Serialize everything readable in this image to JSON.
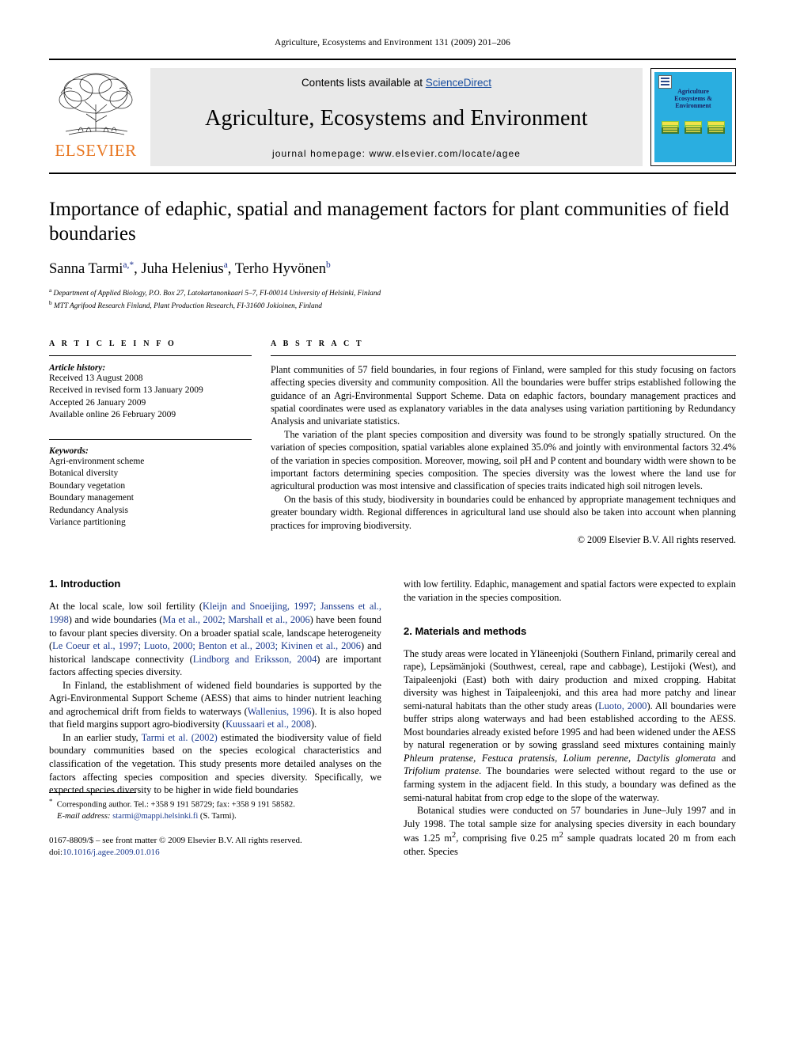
{
  "running_head": "Agriculture, Ecosystems and Environment 131 (2009) 201–206",
  "masthead": {
    "contents_prefix": "Contents lists available at ",
    "sciencedirect": "ScienceDirect",
    "journal_title": "Agriculture, Ecosystems and Environment",
    "homepage": "journal homepage: www.elsevier.com/locate/agee",
    "publisher_wordmark": "ELSEVIER",
    "cover_title": "Agriculture\nEcosystems &\nEnvironment"
  },
  "article": {
    "title": "Importance of edaphic, spatial and management factors for plant communities of field boundaries",
    "authors_html": "Sanna Tarmi<sup>a,*</sup>, Juha Helenius<sup>a</sup>, Terho Hyvönen<sup>b</sup>",
    "affiliation_a": "Department of Applied Biology, P.O. Box 27, Latokartanonkaari 5–7, FI-00014 University of Helsinki, Finland",
    "affiliation_b": "MTT Agrifood Research Finland, Plant Production Research, FI-31600 Jokioinen, Finland"
  },
  "article_info": {
    "heading": "A R T I C L E   I N F O",
    "history_label": "Article history:",
    "history": [
      "Received 13 August 2008",
      "Received in revised form 13 January 2009",
      "Accepted 26 January 2009",
      "Available online 26 February 2009"
    ],
    "keywords_label": "Keywords:",
    "keywords": [
      "Agri-environment scheme",
      "Botanical diversity",
      "Boundary vegetation",
      "Boundary management",
      "Redundancy Analysis",
      "Variance partitioning"
    ]
  },
  "abstract": {
    "heading": "A B S T R A C T",
    "paragraphs": [
      "Plant communities of 57 field boundaries, in four regions of Finland, were sampled for this study focusing on factors affecting species diversity and community composition. All the boundaries were buffer strips established following the guidance of an Agri-Environmental Support Scheme. Data on edaphic factors, boundary management practices and spatial coordinates were used as explanatory variables in the data analyses using variation partitioning by Redundancy Analysis and univariate statistics.",
      "The variation of the plant species composition and diversity was found to be strongly spatially structured. On the variation of species composition, spatial variables alone explained 35.0% and jointly with environmental factors 32.4% of the variation in species composition. Moreover, mowing, soil pH and P content and boundary width were shown to be important factors determining species composition. The species diversity was the lowest where the land use for agricultural production was most intensive and classification of species traits indicated high soil nitrogen levels.",
      "On the basis of this study, biodiversity in boundaries could be enhanced by appropriate management techniques and greater boundary width. Regional differences in agricultural land use should also be taken into account when planning practices for improving biodiversity."
    ],
    "copyright": "© 2009 Elsevier B.V. All rights reserved."
  },
  "sections": {
    "introduction_heading": "1. Introduction",
    "methods_heading": "2. Materials and methods"
  },
  "body": {
    "intro_p1_html": "At the local scale, low soil fertility (<span class=\"cite\">Kleijn and Snoeijing, 1997; Janssens et al., 1998</span>) and wide boundaries (<span class=\"cite\">Ma et al., 2002; Marshall et al., 2006</span>) have been found to favour plant species diversity. On a broader spatial scale, landscape heterogeneity (<span class=\"cite\">Le Coeur et al., 1997; Luoto, 2000; Benton et al., 2003; Kivinen et al., 2006</span>) and historical landscape connectivity (<span class=\"cite\">Lindborg and Eriksson, 2004</span>) are important factors affecting species diversity.",
    "intro_p2_html": "In Finland, the establishment of widened field boundaries is supported by the Agri-Environmental Support Scheme (AESS) that aims to hinder nutrient leaching and agrochemical drift from fields to waterways (<span class=\"cite\">Wallenius, 1996</span>). It is also hoped that field margins support agro-biodiversity (<span class=\"cite\">Kuussaari et al., 2008</span>).",
    "intro_p3_html": "In an earlier study, <span class=\"cite\">Tarmi et al. (2002)</span> estimated the biodiversity value of field boundary communities based on the species ecological characteristics and classification of the vegetation. This study presents more detailed analyses on the factors affecting species composition and species diversity. Specifically, we expected species diversity to be higher in wide field boundaries",
    "intro_p4_html": "with low fertility. Edaphic, management and spatial factors were expected to explain the variation in the species composition.",
    "methods_p1_html": "The study areas were located in Yläneenjoki (Southern Finland, primarily cereal and rape), Lepsämänjoki (Southwest, cereal, rape and cabbage), Lestijoki (West), and Taipaleenjoki (East) both with dairy production and mixed cropping. Habitat diversity was highest in Taipaleenjoki, and this area had more patchy and linear semi-natural habitats than the other study areas (<span class=\"cite\">Luoto, 2000</span>). All boundaries were buffer strips along waterways and had been established according to the AESS. Most boundaries already existed before 1995 and had been widened under the AESS by natural regeneration or by sowing grassland seed mixtures containing mainly <span class=\"ital\">Phleum pratense</span>, <span class=\"ital\">Festuca pratensis</span>, <span class=\"ital\">Lolium perenne</span>, <span class=\"ital\">Dactylis glomerata</span> and <span class=\"ital\">Trifolium pratense</span>. The boundaries were selected without regard to the use or farming system in the adjacent field. In this study, a boundary was defined as the semi-natural habitat from crop edge to the slope of the waterway.",
    "methods_p2_html": "Botanical studies were conducted on 57 boundaries in June–July 1997 and in July 1998. The total sample size for analysing species diversity in each boundary was 1.25 m<sup>2</sup>, comprising five 0.25 m<sup>2</sup> sample quadrats located 20 m from each other. Species"
  },
  "footnotes": {
    "corresponding_html": "<sup>*</sup>&nbsp; Corresponding author. Tel.: +358 9 191 58729; fax: +358 9 191 58582.",
    "email_html": "<span class=\"ital\">E-mail address:</span> <span class=\"link\">starmi@mappi.helsinki.fi</span> (S. Tarmi).",
    "imprint_line1": "0167-8809/$ – see front matter © 2009 Elsevier B.V. All rights reserved.",
    "imprint_doi_prefix": "doi:",
    "imprint_doi": "10.1016/j.agee.2009.01.016"
  },
  "colors": {
    "link": "#1b3a8f",
    "elsevier_orange": "#E87722",
    "cover_blue": "#2aaee0",
    "masthead_grey": "#e9e9e9"
  }
}
